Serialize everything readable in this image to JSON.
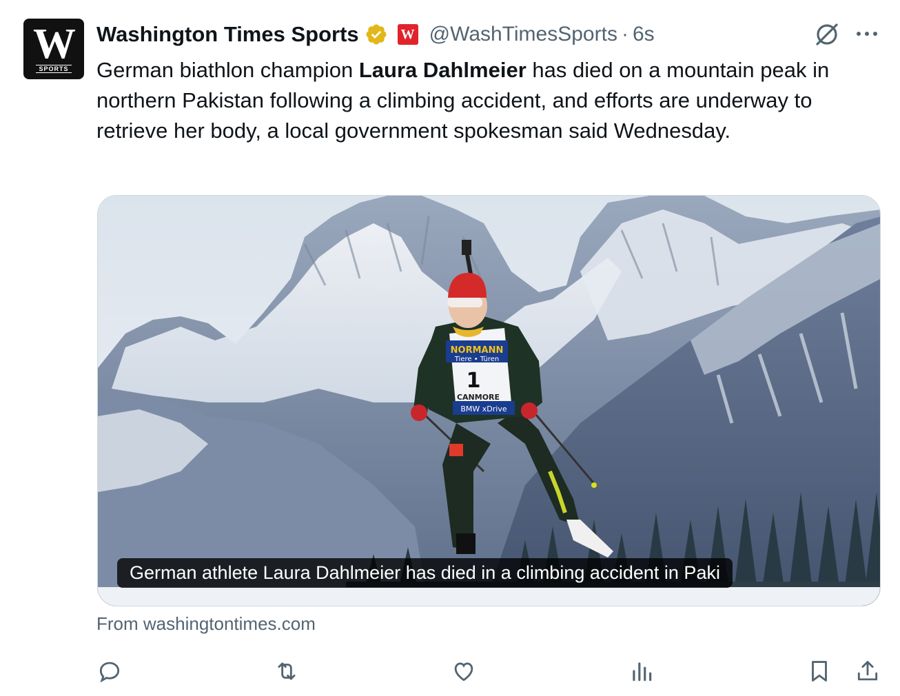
{
  "post": {
    "author_name": "Washington Times Sports",
    "handle": "@WashTimesSports",
    "separator": "·",
    "time": "6s",
    "avatar_letter": "W",
    "avatar_subtext": "SPORTS",
    "affiliate_badge_letter": "W",
    "text_before": "German biathlon champion ",
    "text_bold": "Laura Dahlmeier",
    "text_after": " has died on a mountain peak in northern Pakistan following a climbing accident, and efforts are underway to retrieve her body, a local government spokesman said Wednesday.",
    "media_caption": "German athlete Laura Dahlmeier has died in a climbing accident in Paki",
    "bib_number": "1",
    "bib_text_top": "NORMANN",
    "bib_text_sub": "Tiere • Türen",
    "bib_text_mid": "CANMORE",
    "bib_text_bottom": "BMW xDrive",
    "source": "From washingtontimes.com"
  },
  "icons": {
    "verified": "verified-badge-icon",
    "grok": "grok-icon",
    "more": "more-icon",
    "reply": "reply-icon",
    "repost": "repost-icon",
    "like": "like-icon",
    "views": "views-icon",
    "bookmark": "bookmark-icon",
    "share": "share-icon"
  },
  "colors": {
    "verified_gold": "#e2b719",
    "brand_red": "#e0242b",
    "muted_text": "#536471"
  }
}
